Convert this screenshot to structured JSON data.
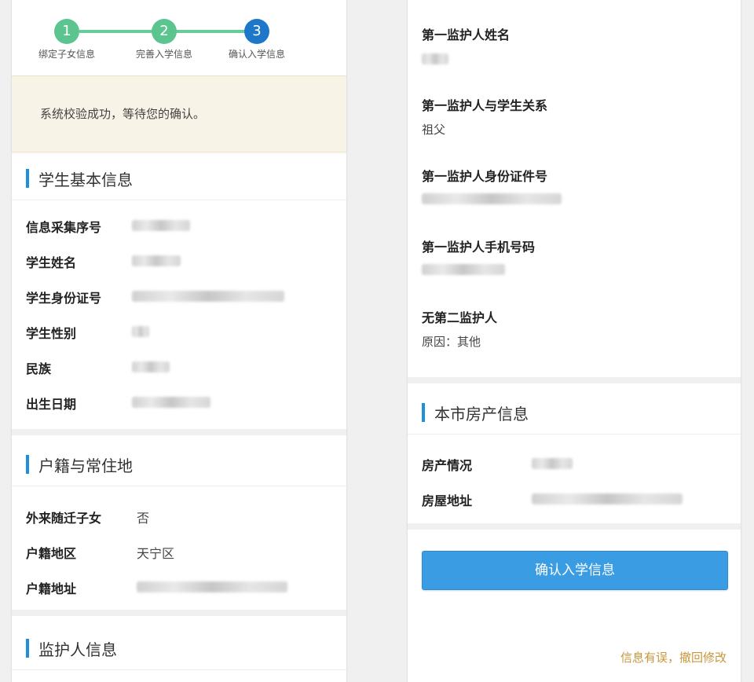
{
  "stepper": {
    "steps": [
      {
        "num": "1",
        "label": "绑定子女信息",
        "color": "#5cc48f"
      },
      {
        "num": "2",
        "label": "完善入学信息",
        "color": "#5cc48f"
      },
      {
        "num": "3",
        "label": "确认入学信息",
        "color": "#1f77c9"
      }
    ]
  },
  "notice": {
    "text": "系统校验成功，等待您的确认。"
  },
  "student_section": {
    "title": "学生基本信息",
    "fields": [
      {
        "label": "信息采集序号"
      },
      {
        "label": "学生姓名"
      },
      {
        "label": "学生身份证号"
      },
      {
        "label": "学生性别"
      },
      {
        "label": "民族"
      },
      {
        "label": "出生日期"
      }
    ]
  },
  "household_section": {
    "title": "户籍与常住地",
    "fields": [
      {
        "label": "外来随迁子女",
        "value": "否"
      },
      {
        "label": "户籍地区",
        "value": "天宁区"
      },
      {
        "label": "户籍地址",
        "value": ""
      }
    ]
  },
  "guardian_section": {
    "title": "监护人信息"
  },
  "guardian_details": {
    "g1_name_label": "第一监护人姓名",
    "g1_relation_label": "第一监护人与学生关系",
    "g1_relation_value": "祖父",
    "g1_id_label": "第一监护人身份证件号",
    "g1_phone_label": "第一监护人手机号码",
    "no_g2_label": "无第二监护人",
    "no_g2_reason": "原因：其他"
  },
  "property_section": {
    "title": "本市房产信息",
    "fields": [
      {
        "label": "房产情况"
      },
      {
        "label": "房屋地址"
      }
    ]
  },
  "actions": {
    "confirm_label": "确认入学信息",
    "revoke_label": "信息有误，撤回修改"
  },
  "colors": {
    "accent": "#3a9de4",
    "section_bar": "#1f8fdc",
    "link": "#c8963a",
    "step_done": "#5cc48f",
    "step_current": "#1f77c9"
  }
}
